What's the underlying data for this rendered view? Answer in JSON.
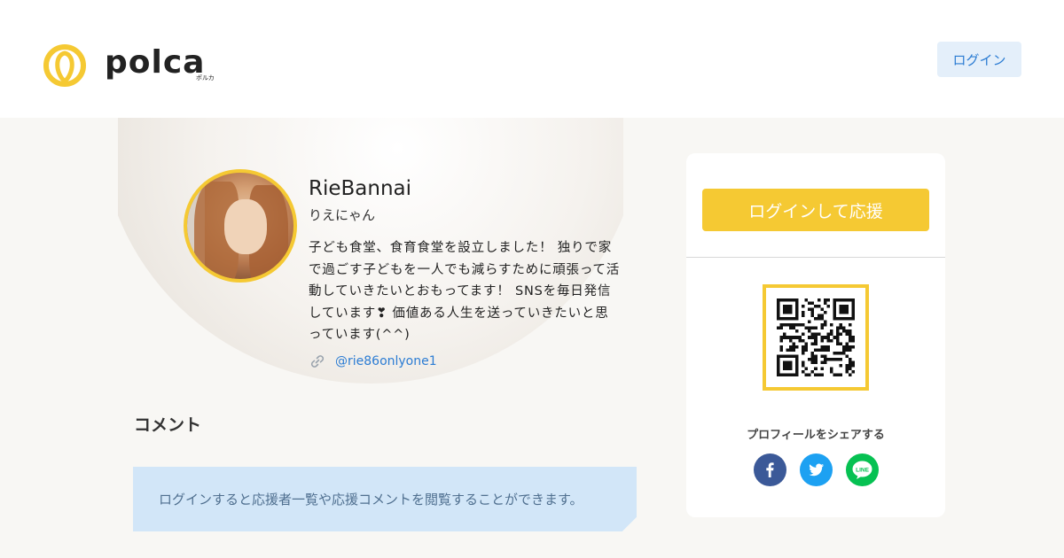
{
  "header": {
    "logo_text": "polca",
    "logo_sub": "ポルカ",
    "login_label": "ログイン"
  },
  "profile": {
    "name": "RieBannai",
    "nickname": "りえにゃん",
    "bio": "子ども食堂、食育食堂を設立しました！ 独りで家で過ごす子どもを一人でも減らすために頑張って活動していきたいとおもってます！ SNSを毎日発信しています❣ 価値ある人生を送っていきたいと思っています(^^)",
    "link": "@rie86onlyone1"
  },
  "comments": {
    "title": "コメント",
    "notice": "ログインすると応援者一覧や応援コメントを閲覧することができます。"
  },
  "sidebar": {
    "support_label": "ログインして応援",
    "share_label": "プロフィールをシェアする"
  },
  "colors": {
    "accent": "#f5c933",
    "link": "#2b7cd3",
    "facebook": "#3b5998",
    "twitter": "#1da1f2",
    "line": "#06c152"
  },
  "icons": {
    "link": "link-icon",
    "facebook": "facebook-icon",
    "twitter": "twitter-icon",
    "line": "line-icon"
  }
}
